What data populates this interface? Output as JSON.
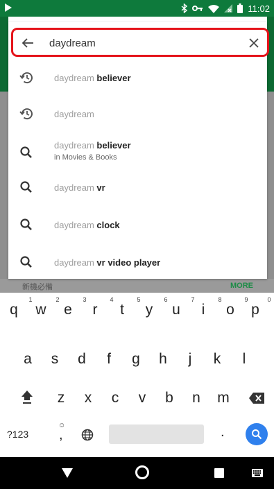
{
  "status_bar": {
    "time": "11:02",
    "colors": {
      "background": "#0e7a3c"
    }
  },
  "search": {
    "query": "daydream",
    "back_icon": "arrow-back-icon",
    "clear_icon": "close-icon",
    "highlight_color": "#e5141b"
  },
  "suggestions": [
    {
      "type": "history",
      "icon": "history-icon",
      "prefix": "daydream",
      "suffix": " believer",
      "subtitle": ""
    },
    {
      "type": "history",
      "icon": "history-icon",
      "prefix": "daydream",
      "suffix": "",
      "subtitle": ""
    },
    {
      "type": "search",
      "icon": "search-icon",
      "prefix": "daydream",
      "suffix": " believer",
      "subtitle": "in Movies & Books"
    },
    {
      "type": "search",
      "icon": "search-icon",
      "prefix": "daydream",
      "suffix": " vr",
      "subtitle": ""
    },
    {
      "type": "search",
      "icon": "search-icon",
      "prefix": "daydream",
      "suffix": " clock",
      "subtitle": ""
    },
    {
      "type": "search",
      "icon": "search-icon",
      "prefix": "daydream",
      "suffix": " vr video player",
      "subtitle": ""
    }
  ],
  "background_page": {
    "section_title": "新機必備",
    "more_label": "MORE"
  },
  "keyboard": {
    "row1": [
      "q",
      "w",
      "e",
      "r",
      "t",
      "y",
      "u",
      "i",
      "o",
      "p"
    ],
    "row1_hints": [
      "1",
      "2",
      "3",
      "4",
      "5",
      "6",
      "7",
      "8",
      "9",
      "0"
    ],
    "row2": [
      "a",
      "s",
      "d",
      "f",
      "g",
      "h",
      "j",
      "k",
      "l"
    ],
    "row3": [
      "z",
      "x",
      "c",
      "v",
      "b",
      "n",
      "m"
    ],
    "symbols_label": "?123",
    "comma_label": ",",
    "emoji_hint": "☺",
    "period_label": ".",
    "accent_color": "#2f80ed"
  },
  "nav_bar": {
    "back_icon": "triangle-back-icon",
    "home_icon": "circle-home-icon",
    "recents_icon": "square-recents-icon",
    "keyboard_icon": "keyboard-icon"
  }
}
